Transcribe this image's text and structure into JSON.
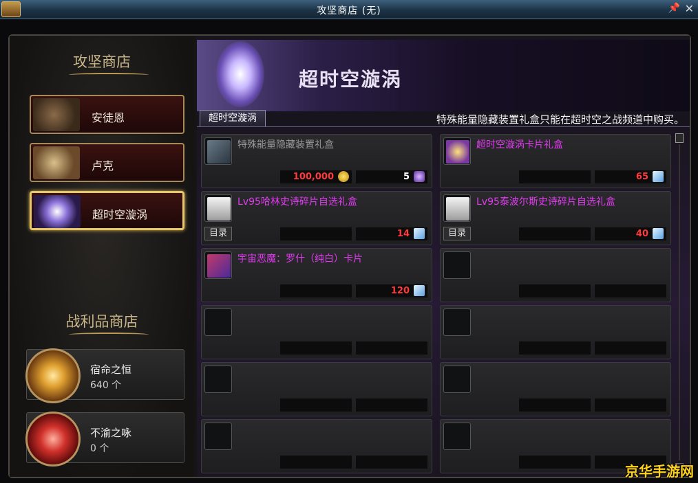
{
  "window": {
    "title": "攻坚商店 (无)"
  },
  "left": {
    "section1_title": "攻坚商店",
    "shops": [
      {
        "label": "安徒恩"
      },
      {
        "label": "卢克"
      },
      {
        "label": "超时空漩涡"
      }
    ],
    "section2_title": "战利品商店",
    "loot": [
      {
        "name": "宿命之恒",
        "count": "640 个"
      },
      {
        "name": "不渝之咏",
        "count": "0 个"
      }
    ]
  },
  "main": {
    "banner_title": "超时空漩涡",
    "tab_label": "超时空漩涡",
    "notice": "特殊能量隐藏装置礼盒只能在超时空之战频道中购买。",
    "items": [
      {
        "name": "特殊能量隐藏装置礼盒",
        "name_color": "#9a9a9a",
        "price1": "100,000",
        "price2": "5",
        "tag": "",
        "icon": "device-box-icon",
        "cur1": "gold-coin-icon",
        "cur2": "purple-orb-icon"
      },
      {
        "name": "超时空漩涡卡片礼盒",
        "name_color": "#e03cf0",
        "price1": "",
        "price2": "65",
        "tag": "",
        "icon": "card-box-icon",
        "cur1": "",
        "cur2": "fragment-icon"
      },
      {
        "name": "Lv95哈林史诗碎片自选礼盒",
        "name_color": "#e03cf0",
        "price1": "",
        "price2": "14",
        "tag": "目录",
        "icon": "epic-box-icon",
        "cur1": "",
        "cur2": "fragment-icon"
      },
      {
        "name": "Lv95泰波尔斯史诗碎片自选礼盒",
        "name_color": "#e03cf0",
        "price1": "",
        "price2": "40",
        "tag": "目录",
        "icon": "epic-box-icon",
        "cur1": "",
        "cur2": "fragment-icon"
      },
      {
        "name": "宇宙恶魔：罗什（纯白）卡片",
        "name_color": "#e03cf0",
        "price1": "",
        "price2": "120",
        "tag": "",
        "icon": "card-icon",
        "cur1": "",
        "cur2": "fragment-icon"
      },
      {
        "name": "",
        "name_color": "#999",
        "price1": "",
        "price2": "",
        "tag": "",
        "icon": "",
        "cur1": "",
        "cur2": ""
      },
      {
        "name": "",
        "name_color": "#999",
        "price1": "",
        "price2": "",
        "tag": "",
        "icon": "",
        "cur1": "",
        "cur2": ""
      },
      {
        "name": "",
        "name_color": "#999",
        "price1": "",
        "price2": "",
        "tag": "",
        "icon": "",
        "cur1": "",
        "cur2": ""
      },
      {
        "name": "",
        "name_color": "#999",
        "price1": "",
        "price2": "",
        "tag": "",
        "icon": "",
        "cur1": "",
        "cur2": ""
      },
      {
        "name": "",
        "name_color": "#999",
        "price1": "",
        "price2": "",
        "tag": "",
        "icon": "",
        "cur1": "",
        "cur2": ""
      },
      {
        "name": "",
        "name_color": "#999",
        "price1": "",
        "price2": "",
        "tag": "",
        "icon": "",
        "cur1": "",
        "cur2": ""
      },
      {
        "name": "",
        "name_color": "#999",
        "price1": "",
        "price2": "",
        "tag": "",
        "icon": "",
        "cur1": "",
        "cur2": ""
      }
    ],
    "price_color": "#ff3a3a"
  },
  "watermark": "京华手游网"
}
